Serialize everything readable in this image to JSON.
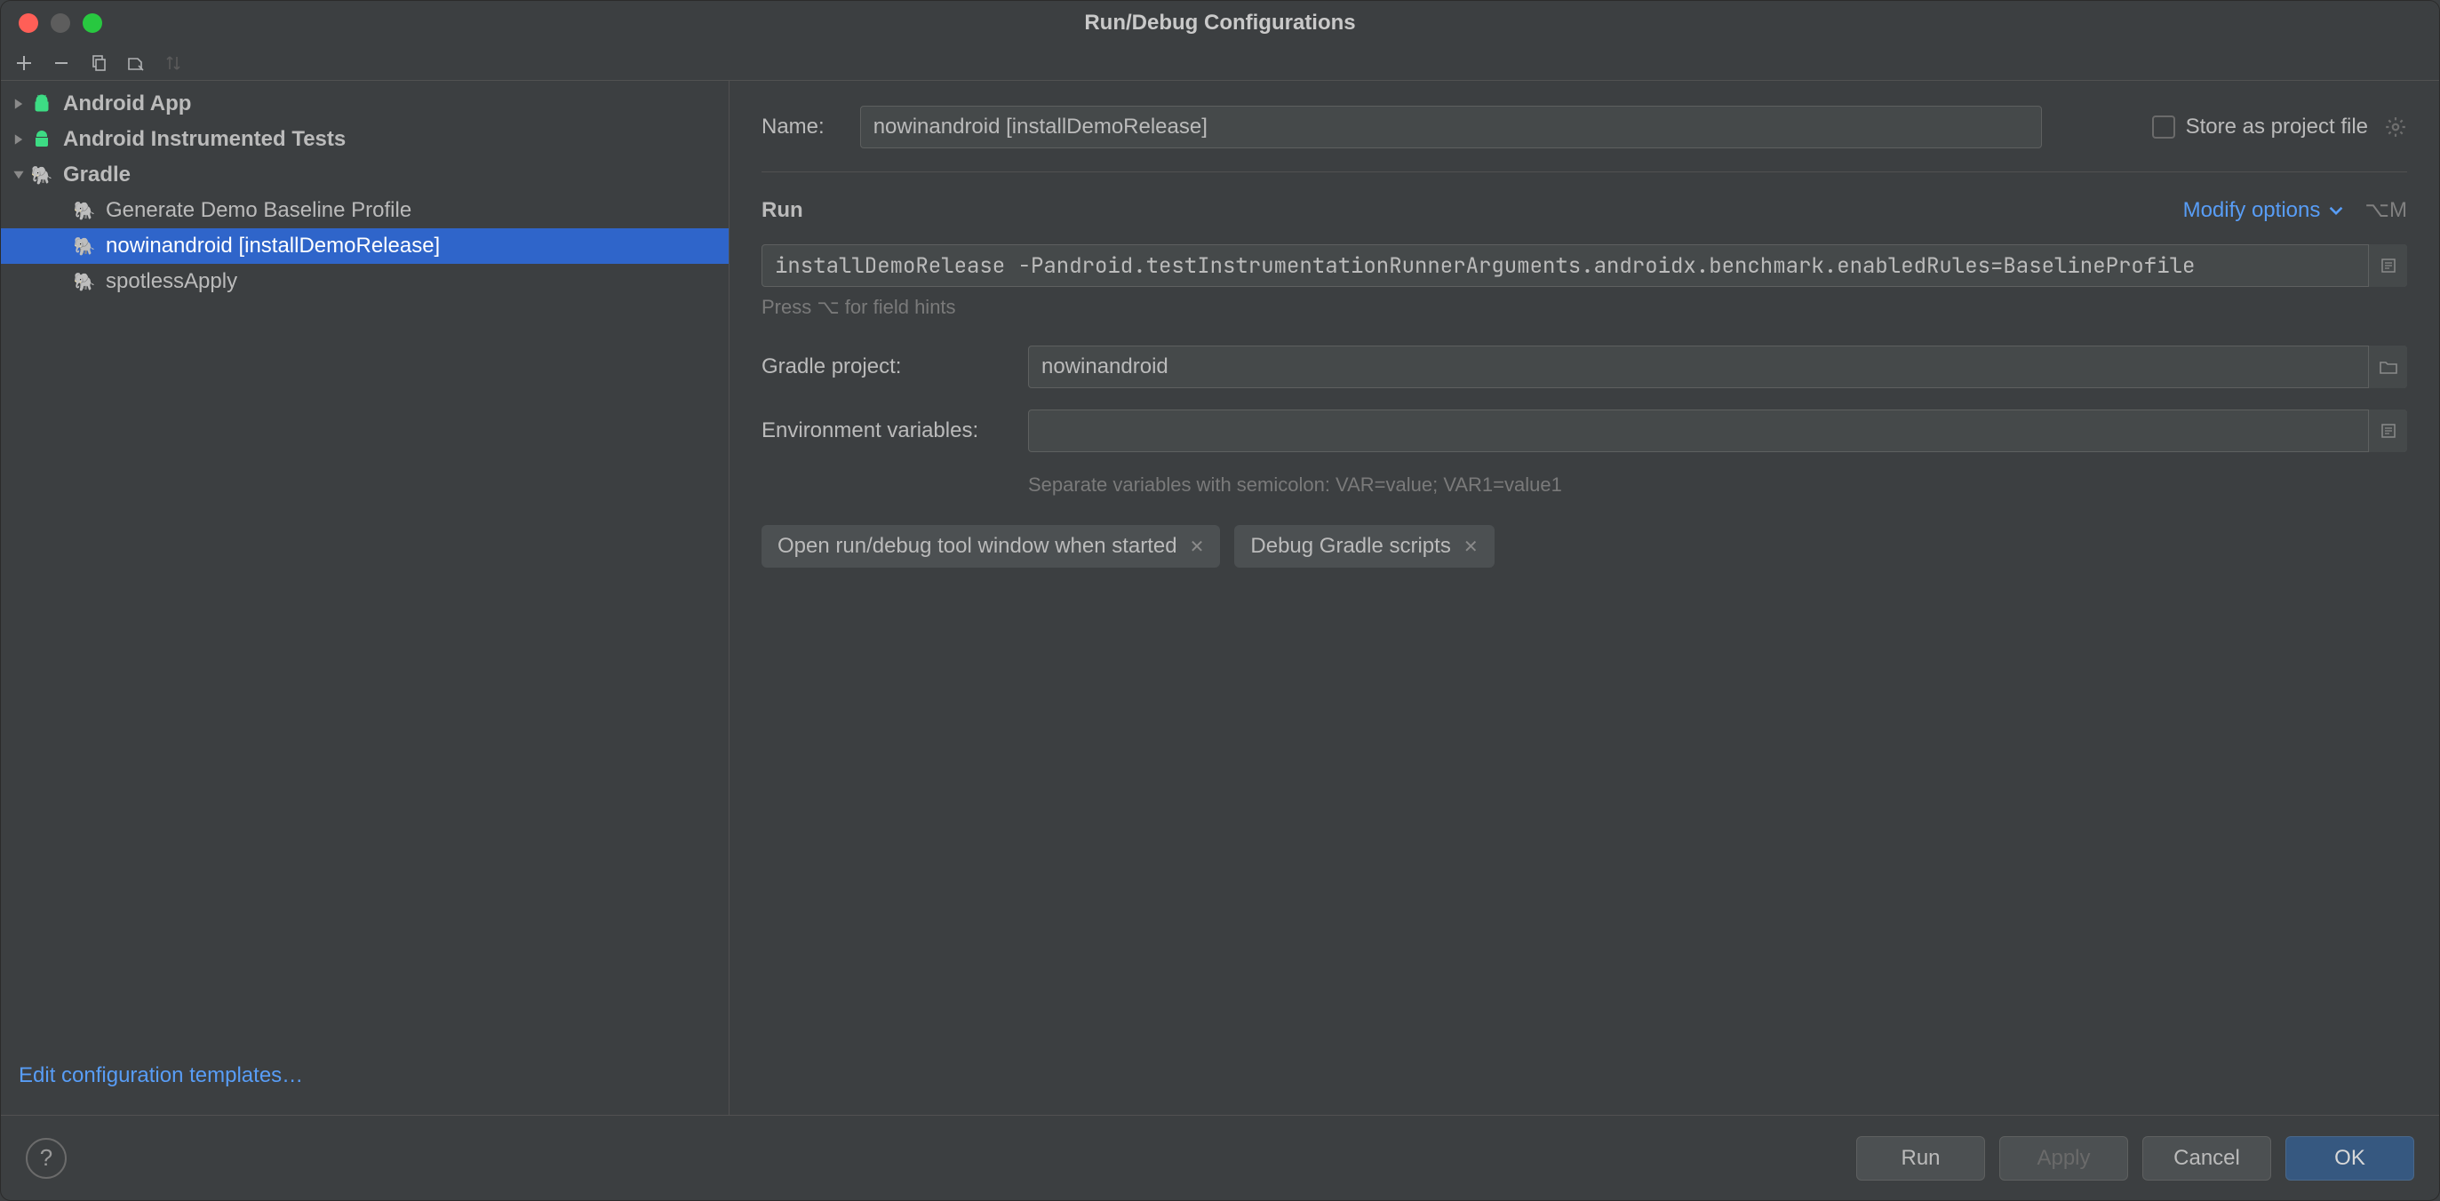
{
  "window": {
    "title": "Run/Debug Configurations"
  },
  "tree": {
    "groups": [
      {
        "id": "android-app",
        "label": "Android App",
        "expanded": false,
        "icon": "android"
      },
      {
        "id": "android-tests",
        "label": "Android Instrumented Tests",
        "expanded": false,
        "icon": "android"
      },
      {
        "id": "gradle",
        "label": "Gradle",
        "expanded": true,
        "icon": "gradle",
        "items": [
          {
            "id": "gen-baseline",
            "label": "Generate Demo Baseline Profile",
            "selected": false
          },
          {
            "id": "install-demo",
            "label": "nowinandroid [installDemoRelease]",
            "selected": true
          },
          {
            "id": "spotless",
            "label": "spotlessApply",
            "selected": false
          }
        ]
      }
    ]
  },
  "edit_templates": "Edit configuration templates…",
  "form": {
    "name_label": "Name:",
    "name_value": "nowinandroid [installDemoRelease]",
    "store_label": "Store as project file",
    "run_section": "Run",
    "modify_options": "Modify options",
    "modify_shortcut": "⌥M",
    "tasks_value": "installDemoRelease -Pandroid.testInstrumentationRunnerArguments.androidx.benchmark.enabledRules=BaselineProfile",
    "tasks_hint": "Press ⌥ for field hints",
    "gradle_project_label": "Gradle project:",
    "gradle_project_value": "nowinandroid",
    "env_label": "Environment variables:",
    "env_value": "",
    "env_hint": "Separate variables with semicolon: VAR=value; VAR1=value1",
    "chips": [
      {
        "id": "open-tool",
        "label": "Open run/debug tool window when started"
      },
      {
        "id": "debug-gradle",
        "label": "Debug Gradle scripts"
      }
    ]
  },
  "footer": {
    "run": "Run",
    "apply": "Apply",
    "cancel": "Cancel",
    "ok": "OK"
  }
}
